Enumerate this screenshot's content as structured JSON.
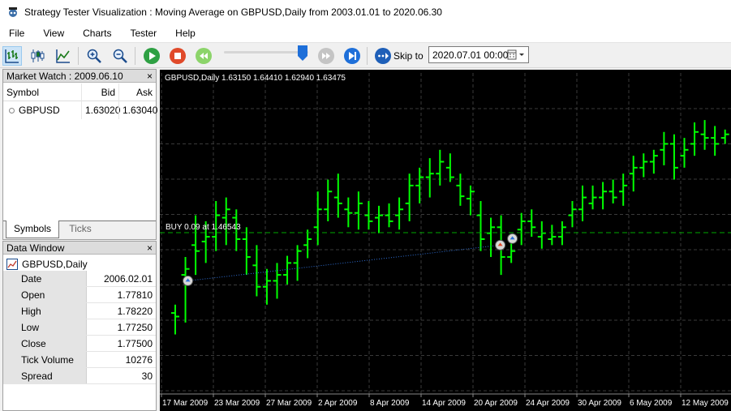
{
  "window": {
    "title": "Strategy Tester Visualization : Moving Average on GBPUSD,Daily from 2003.01.01 to 2020.06.30"
  },
  "menu": [
    "File",
    "View",
    "Charts",
    "Tester",
    "Help"
  ],
  "toolbar": {
    "skip_label": "Skip to",
    "skip_date": "2020.07.01 00:00"
  },
  "market_watch": {
    "title": "Market Watch : 2009.06.10",
    "columns": [
      "Symbol",
      "Bid",
      "Ask"
    ],
    "rows": [
      {
        "symbol": "GBPUSD",
        "bid": "1.63020",
        "ask": "1.63040"
      }
    ],
    "tabs": [
      "Symbols",
      "Ticks"
    ]
  },
  "data_window": {
    "title": "Data Window",
    "series": "GBPUSD,Daily",
    "rows": [
      {
        "label": "Date",
        "value": "2006.02.01"
      },
      {
        "label": "Open",
        "value": "1.77810"
      },
      {
        "label": "High",
        "value": "1.78220"
      },
      {
        "label": "Low",
        "value": "1.77250"
      },
      {
        "label": "Close",
        "value": "1.77500"
      },
      {
        "label": "Tick Volume",
        "value": "10276"
      },
      {
        "label": "Spread",
        "value": "30"
      }
    ]
  },
  "chart": {
    "header": "GBPUSD,Daily  1.63150 1.64410 1.62940 1.63475",
    "trade_label": "BUY 0.09 at 1.46543",
    "x_ticks": [
      "17 Mar 2009",
      "23 Mar 2009",
      "27 Mar 2009",
      "2 Apr 2009",
      "8 Apr 2009",
      "14 Apr 2009",
      "20 Apr 2009",
      "24 Apr 2009",
      "30 Apr 2009",
      "6 May 2009",
      "12 May 2009"
    ],
    "colors": {
      "background": "#000000",
      "bar": "#00ff00",
      "grid": "#3a3a3a",
      "trade_line": "#00aa00"
    }
  },
  "chart_data": {
    "type": "ohlc",
    "bars": [
      {
        "o": 1.398,
        "h": 1.405,
        "l": 1.38,
        "c": 1.395
      },
      {
        "o": 1.43,
        "h": 1.445,
        "l": 1.39,
        "c": 1.435
      },
      {
        "o": 1.455,
        "h": 1.48,
        "l": 1.43,
        "c": 1.45
      },
      {
        "o": 1.458,
        "h": 1.475,
        "l": 1.44,
        "c": 1.462
      },
      {
        "o": 1.462,
        "h": 1.492,
        "l": 1.45,
        "c": 1.48
      },
      {
        "o": 1.478,
        "h": 1.495,
        "l": 1.455,
        "c": 1.485
      },
      {
        "o": 1.478,
        "h": 1.485,
        "l": 1.45,
        "c": 1.46
      },
      {
        "o": 1.46,
        "h": 1.47,
        "l": 1.43,
        "c": 1.445
      },
      {
        "o": 1.438,
        "h": 1.455,
        "l": 1.412,
        "c": 1.42
      },
      {
        "o": 1.42,
        "h": 1.435,
        "l": 1.405,
        "c": 1.425
      },
      {
        "o": 1.425,
        "h": 1.44,
        "l": 1.41,
        "c": 1.43
      },
      {
        "o": 1.43,
        "h": 1.446,
        "l": 1.422,
        "c": 1.44
      },
      {
        "o": 1.44,
        "h": 1.455,
        "l": 1.425,
        "c": 1.45
      },
      {
        "o": 1.455,
        "h": 1.468,
        "l": 1.444,
        "c": 1.46
      },
      {
        "o": 1.47,
        "h": 1.5,
        "l": 1.455,
        "c": 1.485
      },
      {
        "o": 1.485,
        "h": 1.51,
        "l": 1.475,
        "c": 1.5
      },
      {
        "o": 1.495,
        "h": 1.515,
        "l": 1.478,
        "c": 1.49
      },
      {
        "o": 1.485,
        "h": 1.495,
        "l": 1.47,
        "c": 1.482
      },
      {
        "o": 1.482,
        "h": 1.5,
        "l": 1.468,
        "c": 1.49
      },
      {
        "o": 1.48,
        "h": 1.492,
        "l": 1.468,
        "c": 1.475
      },
      {
        "o": 1.478,
        "h": 1.488,
        "l": 1.465,
        "c": 1.48
      },
      {
        "o": 1.48,
        "h": 1.49,
        "l": 1.47,
        "c": 1.475
      },
      {
        "o": 1.48,
        "h": 1.495,
        "l": 1.468,
        "c": 1.485
      },
      {
        "o": 1.49,
        "h": 1.515,
        "l": 1.475,
        "c": 1.505
      },
      {
        "o": 1.505,
        "h": 1.52,
        "l": 1.49,
        "c": 1.512
      },
      {
        "o": 1.512,
        "h": 1.528,
        "l": 1.495,
        "c": 1.515
      },
      {
        "o": 1.515,
        "h": 1.535,
        "l": 1.505,
        "c": 1.525
      },
      {
        "o": 1.52,
        "h": 1.532,
        "l": 1.508,
        "c": 1.512
      },
      {
        "o": 1.505,
        "h": 1.515,
        "l": 1.488,
        "c": 1.496
      },
      {
        "o": 1.494,
        "h": 1.505,
        "l": 1.48,
        "c": 1.5
      },
      {
        "o": 1.48,
        "h": 1.492,
        "l": 1.45,
        "c": 1.46
      },
      {
        "o": 1.465,
        "h": 1.478,
        "l": 1.445,
        "c": 1.47
      },
      {
        "o": 1.47,
        "h": 1.48,
        "l": 1.43,
        "c": 1.445
      },
      {
        "o": 1.445,
        "h": 1.46,
        "l": 1.44,
        "c": 1.45
      },
      {
        "o": 1.468,
        "h": 1.482,
        "l": 1.455,
        "c": 1.475
      },
      {
        "o": 1.475,
        "h": 1.485,
        "l": 1.462,
        "c": 1.47
      },
      {
        "o": 1.462,
        "h": 1.475,
        "l": 1.452,
        "c": 1.465
      },
      {
        "o": 1.46,
        "h": 1.472,
        "l": 1.455,
        "c": 1.462
      },
      {
        "o": 1.462,
        "h": 1.475,
        "l": 1.455,
        "c": 1.47
      },
      {
        "o": 1.48,
        "h": 1.492,
        "l": 1.47,
        "c": 1.485
      },
      {
        "o": 1.485,
        "h": 1.505,
        "l": 1.475,
        "c": 1.495
      },
      {
        "o": 1.49,
        "h": 1.505,
        "l": 1.485,
        "c": 1.495
      },
      {
        "o": 1.495,
        "h": 1.508,
        "l": 1.485,
        "c": 1.5
      },
      {
        "o": 1.5,
        "h": 1.51,
        "l": 1.49,
        "c": 1.495
      },
      {
        "o": 1.5,
        "h": 1.515,
        "l": 1.488,
        "c": 1.505
      },
      {
        "o": 1.515,
        "h": 1.53,
        "l": 1.5,
        "c": 1.52
      },
      {
        "o": 1.52,
        "h": 1.532,
        "l": 1.512,
        "c": 1.525
      },
      {
        "o": 1.525,
        "h": 1.535,
        "l": 1.515,
        "c": 1.53
      },
      {
        "o": 1.535,
        "h": 1.55,
        "l": 1.522,
        "c": 1.54
      },
      {
        "o": 1.54,
        "h": 1.548,
        "l": 1.51,
        "c": 1.52
      },
      {
        "o": 1.53,
        "h": 1.545,
        "l": 1.52,
        "c": 1.535
      },
      {
        "o": 1.54,
        "h": 1.558,
        "l": 1.53,
        "c": 1.55
      },
      {
        "o": 1.548,
        "h": 1.56,
        "l": 1.535,
        "c": 1.545
      },
      {
        "o": 1.545,
        "h": 1.555,
        "l": 1.53,
        "c": 1.54
      },
      {
        "o": 1.545,
        "h": 1.552,
        "l": 1.54,
        "c": 1.548
      }
    ],
    "trade_price": 1.46543
  }
}
